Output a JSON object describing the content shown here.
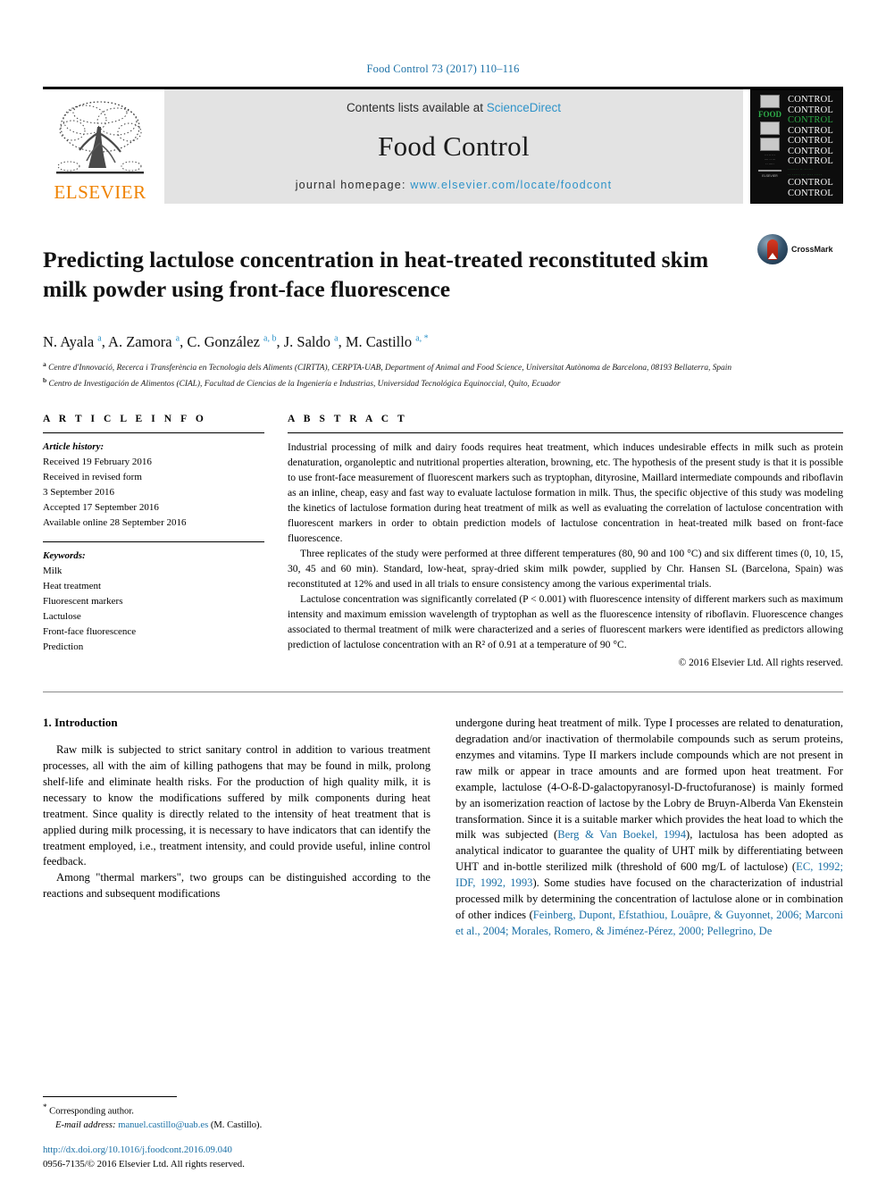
{
  "running_head": "Food Control 73 (2017) 110–116",
  "masthead": {
    "publisher_logo_text": "ELSEVIER",
    "contents_prefix": "Contents lists available at ",
    "contents_link": "ScienceDirect",
    "journal_title": "Food Control",
    "homepage_prefix": "journal homepage: ",
    "homepage_url": "www.elsevier.com/locate/foodcont",
    "cover": {
      "food_word": "FOOD",
      "control_word": "CONTROL",
      "control_repeat": 9,
      "tagline": "ELSEVIER"
    }
  },
  "article": {
    "title": "Predicting lactulose concentration in heat-treated reconstituted skim milk powder using front-face fluorescence",
    "crossmark_label": "CrossMark",
    "authors_html": "N. Ayala <sup>a</sup>, A. Zamora <sup>a</sup>, C. González <sup>a, b</sup>, J. Saldo <sup>a</sup>, M. Castillo <sup>a, *</sup>",
    "affiliation_a": "Centre d'Innovació, Recerca i Transferència en Tecnologia dels Aliments (CIRTTA), CERPTA-UAB, Department of Animal and Food Science, Universitat Autònoma de Barcelona, 08193 Bellaterra, Spain",
    "affiliation_b": "Centro de Investigación de Alimentos (CIAL), Facultad de Ciencias de la Ingeniería e Industrias, Universidad Tecnológica Equinoccial, Quito, Ecuador"
  },
  "article_info": {
    "heading": "A R T I C L E   I N F O",
    "history_label": "Article history:",
    "history": [
      "Received 19 February 2016",
      "Received in revised form",
      "3 September 2016",
      "Accepted 17 September 2016",
      "Available online 28 September 2016"
    ],
    "keywords_label": "Keywords:",
    "keywords": [
      "Milk",
      "Heat treatment",
      "Fluorescent markers",
      "Lactulose",
      "Front-face fluorescence",
      "Prediction"
    ]
  },
  "abstract": {
    "heading": "A B S T R A C T",
    "paragraphs": [
      "Industrial processing of milk and dairy foods requires heat treatment, which induces undesirable effects in milk such as protein denaturation, organoleptic and nutritional properties alteration, browning, etc. The hypothesis of the present study is that it is possible to use front-face measurement of fluorescent markers such as tryptophan, dityrosine, Maillard intermediate compounds and riboflavin as an inline, cheap, easy and fast way to evaluate lactulose formation in milk. Thus, the specific objective of this study was modeling the kinetics of lactulose formation during heat treatment of milk as well as evaluating the correlation of lactulose concentration with fluorescent markers in order to obtain prediction models of lactulose concentration in heat-treated milk based on front-face fluorescence.",
      "Three replicates of the study were performed at three different temperatures (80, 90 and 100 °C) and six different times (0, 10, 15, 30, 45 and 60 min). Standard, low-heat, spray-dried skim milk powder, supplied by Chr. Hansen SL (Barcelona, Spain) was reconstituted at 12% and used in all trials to ensure consistency among the various experimental trials.",
      "Lactulose concentration was significantly correlated (P < 0.001) with fluorescence intensity of different markers such as maximum intensity and maximum emission wavelength of tryptophan as well as the fluorescence intensity of riboflavin. Fluorescence changes associated to thermal treatment of milk were characterized and a series of fluorescent markers were identified as predictors allowing prediction of lactulose concentration with an R² of 0.91 at a temperature of 90 °C."
    ],
    "copyright": "© 2016 Elsevier Ltd. All rights reserved."
  },
  "introduction": {
    "heading": "1. Introduction",
    "left_paragraphs": [
      "Raw milk is subjected to strict sanitary control in addition to various treatment processes, all with the aim of killing pathogens that may be found in milk, prolong shelf-life and eliminate health risks. For the production of high quality milk, it is necessary to know the modifications suffered by milk components during heat treatment. Since quality is directly related to the intensity of heat treatment that is applied during milk processing, it is necessary to have indicators that can identify the treatment employed, i.e., treatment intensity, and could provide useful, inline control feedback.",
      "Among \"thermal markers\", two groups can be distinguished according to the reactions and subsequent modifications"
    ],
    "right_segments": [
      {
        "type": "text",
        "value": "undergone during heat treatment of milk. Type I processes are related to denaturation, degradation and/or inactivation of thermolabile compounds such as serum proteins, enzymes and vitamins. Type II markers include compounds which are not present in raw milk or appear in trace amounts and are formed upon heat treatment. For example, lactulose (4-O-ß-D-galactopyranosyl-D-fructofuranose) is mainly formed by an isomerization reaction of lactose by the Lobry de Bruyn-Alberda Van Ekenstein transformation. Since it is a suitable marker which provides the heat load to which the milk was subjected ("
      },
      {
        "type": "ref",
        "value": "Berg & Van Boekel, 1994"
      },
      {
        "type": "text",
        "value": "), lactulosa has been adopted as analytical indicator to guarantee the quality of UHT milk by differentiating between UHT and in-bottle sterilized milk (threshold of 600 mg/L of lactulose) ("
      },
      {
        "type": "ref",
        "value": "EC, 1992; IDF, 1992, 1993"
      },
      {
        "type": "text",
        "value": "). Some studies have focused on the characterization of industrial processed milk by determining the concentration of lactulose alone or in combination of other indices ("
      },
      {
        "type": "ref",
        "value": "Feinberg, Dupont, Efstathiou, Louâpre, & Guyonnet, 2006; Marconi et al., 2004; Morales, Romero, & Jiménez-Pérez, 2000; Pellegrino, De"
      }
    ]
  },
  "footer": {
    "corresponding_marker": "*",
    "corresponding_label": "Corresponding author.",
    "email_label": "E-mail address:",
    "email": "manuel.castillo@uab.es",
    "email_suffix": "(M. Castillo).",
    "doi": "http://dx.doi.org/10.1016/j.foodcont.2016.09.040",
    "issn_line": "0956-7135/© 2016 Elsevier Ltd. All rights reserved."
  }
}
